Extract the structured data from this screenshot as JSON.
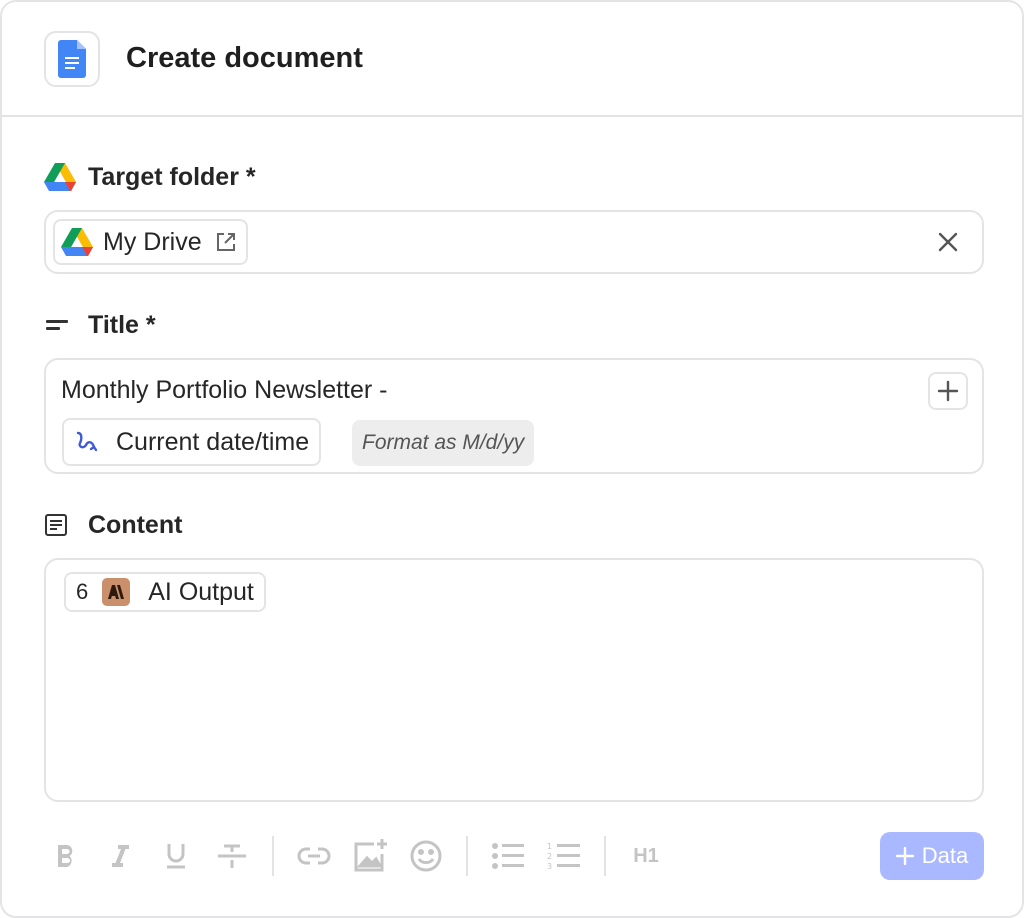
{
  "header": {
    "title": "Create document",
    "icon": "google-docs-icon"
  },
  "target_folder": {
    "label": "Target folder *",
    "icon": "google-drive-icon",
    "chip": {
      "text": "My Drive",
      "icon": "google-drive-icon",
      "action_icon": "external-link-icon"
    },
    "clear_icon": "close-icon"
  },
  "title_field": {
    "label": "Title *",
    "icon": "short-text-icon",
    "text": "Monthly Portfolio Newsletter -",
    "variable_chip": {
      "text": "Current date/time",
      "icon": "variable-icon"
    },
    "format_chip": {
      "text": "Format as M/d/yy"
    },
    "add_icon": "plus-icon"
  },
  "content_field": {
    "label": "Content",
    "icon": "document-lines-icon",
    "chip": {
      "step": "6",
      "text": "AI Output",
      "icon": "anthropic-icon",
      "icon_color": "#c9906b"
    }
  },
  "toolbar": {
    "items": [
      "bold-icon",
      "italic-icon",
      "underline-icon",
      "strikethrough-icon",
      "link-icon",
      "add-image-icon",
      "emoji-icon",
      "bullet-list-icon",
      "numbered-list-icon"
    ],
    "heading_label": "H1",
    "data_button": {
      "label": "Data",
      "icon": "plus-icon",
      "color": "#aab9ff"
    }
  },
  "colors": {
    "border": "#e4e4e7",
    "muted_icon": "#c4c4c4",
    "accent": "#aab9ff"
  }
}
